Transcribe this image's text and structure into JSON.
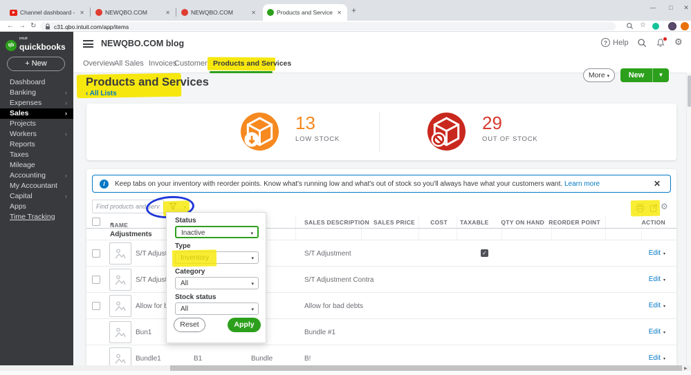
{
  "icons": {
    "close": "✕",
    "plus": "+",
    "minimize": "—",
    "maximize": "□",
    "back": "←",
    "forward": "→",
    "refresh": "↻",
    "star": "☆",
    "caret_down": "▼",
    "caret_small": "▾",
    "chevron_right": "›",
    "chevron_left": "‹",
    "sort_asc": "▲",
    "check": "✓",
    "gear": "⚙",
    "scroll_right": "▶",
    "info": "i",
    "help": "?"
  },
  "browser": {
    "tabs": [
      {
        "title": "Channel dashboard - YouTube S"
      },
      {
        "title": "NEWQBO.COM"
      },
      {
        "title": "NEWQBO.COM"
      },
      {
        "title": "Products and Services"
      }
    ],
    "url": "c31.qbo.intuit.com/app/items"
  },
  "sidebar": {
    "brand_small": "intuit",
    "brand": "quickbooks",
    "logo_monogram": "qb",
    "new_button": "+  New",
    "items": [
      {
        "label": "Dashboard"
      },
      {
        "label": "Banking",
        "chevron": true
      },
      {
        "label": "Expenses",
        "chevron": true
      },
      {
        "label": "Sales",
        "chevron": true,
        "active": true
      },
      {
        "label": "Projects"
      },
      {
        "label": "Workers",
        "chevron": true
      },
      {
        "label": "Reports"
      },
      {
        "label": "Taxes"
      },
      {
        "label": "Mileage"
      },
      {
        "label": "Accounting",
        "chevron": true
      },
      {
        "label": "My Accountant"
      },
      {
        "label": "Capital",
        "chevron": true
      },
      {
        "label": "Apps"
      },
      {
        "label": "Time Tracking"
      }
    ]
  },
  "header": {
    "company": "NEWQBO.COM blog",
    "help": "Help"
  },
  "nav": {
    "tabs": [
      "Overview",
      "All Sales",
      "Invoices",
      "Customers",
      "Products and Services"
    ]
  },
  "page": {
    "title": "Products and Services",
    "back_link": "All Lists",
    "more_button": "More",
    "new_button": "New"
  },
  "stats": {
    "low": {
      "value": "13",
      "label": "LOW STOCK"
    },
    "out": {
      "value": "29",
      "label": "OUT OF STOCK"
    }
  },
  "banner": {
    "text": "Keep tabs on your inventory with reorder points. Know what's running low and what's out of stock so you'll always have what your customers want. ",
    "link": "Learn more"
  },
  "toolbar": {
    "search_placeholder": "Find products and services"
  },
  "filter": {
    "status_label": "Status",
    "status_value": "Inactive",
    "type_label": "Type",
    "type_value": "Inventory",
    "category_label": "Category",
    "category_value": "All",
    "stock_label": "Stock status",
    "stock_value": "All",
    "reset": "Reset",
    "apply": "Apply"
  },
  "table": {
    "headers": {
      "name": "NAME",
      "sales_description": "SALES DESCRIPTION",
      "sales_price": "SALES PRICE",
      "cost": "COST",
      "taxable": "TAXABLE",
      "qty_on_hand": "QTY ON HAND",
      "reorder_point": "REORDER POINT",
      "action": "ACTION"
    },
    "category": "Adjustments",
    "edit": "Edit",
    "rows": [
      {
        "name": "S/T Adjustment",
        "sales_description": "S/T Adjustment"
      },
      {
        "name": "S/T Adjustment",
        "sales_description": "S/T Adjustment Contra"
      },
      {
        "name": "Allow for bad debts",
        "sales_description": "Allow for bad debts"
      },
      {
        "name": "Bun1",
        "sales_description": "Bundle #1"
      },
      {
        "name": "Bundle1",
        "sku": "B1",
        "type": "Bundle",
        "sales_description": "B!"
      }
    ]
  },
  "colors": {
    "qb_green": "#2ca01c",
    "accent_blue": "#0077c5",
    "low_stock_orange": "#f6891f",
    "out_of_stock_red": "#c9281e",
    "highlight_yellow": "#f6e70e",
    "annotation_blue": "#2038d8"
  }
}
